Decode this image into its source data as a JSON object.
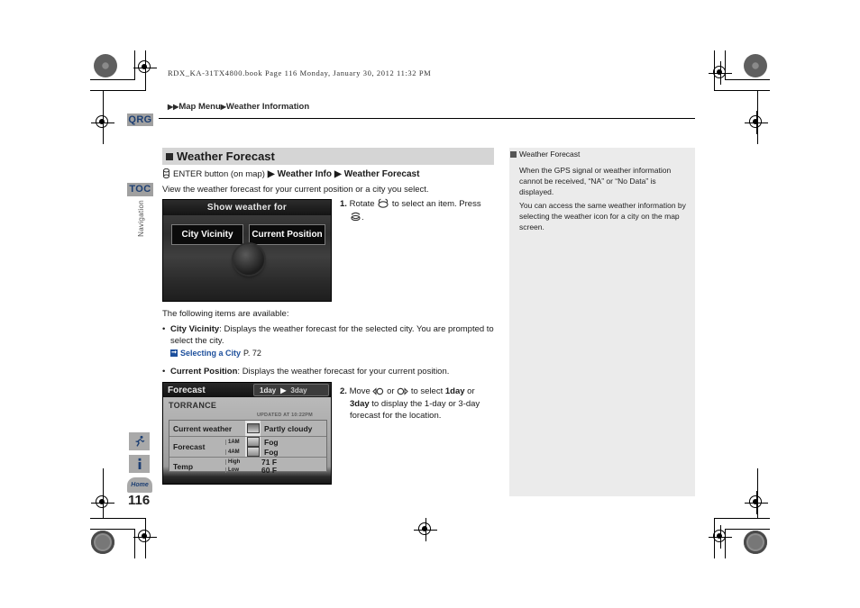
{
  "print": {
    "file_header": "RDX_KA-31TX4800.book  Page 116  Monday, January 30, 2012  11:32 PM",
    "page_number": "116"
  },
  "breadcrumb": {
    "tri1": "▶",
    "tri2": "▶",
    "item1": "Map Menu",
    "tri3": "▶",
    "item2": "Weather Information"
  },
  "rail": {
    "qrg": "QRG",
    "toc": "TOC",
    "vertical_label": "Navigation",
    "home": "Home"
  },
  "section": {
    "title": "Weather Forecast",
    "nav_path": {
      "enter": "ENTER button (on map)",
      "arrow1": "▶",
      "step1": "Weather Info",
      "arrow2": "▶",
      "step2": "Weather Forecast"
    },
    "intro": "View the weather forecast for your current position or a city you select.",
    "items_lead": "The following items are available:"
  },
  "steps": [
    {
      "num": "1.",
      "line1_a": "Rotate",
      "line1_b": "to select an item. Press"
    },
    {
      "num": "2.",
      "line1_a": "Move",
      "line1_b": "or",
      "line1_c": "to select",
      "bold1": "1day",
      "line1_d": "or",
      "bold2": "3day",
      "line2": "to display the 1-day or 3-day",
      "line3": "forecast for the location."
    }
  ],
  "bullets": [
    {
      "label": "City Vicinity",
      "text": ": Displays the weather forecast for the selected city. You are prompted to select the city.",
      "ref_label": "Selecting a City",
      "ref_page": "P. 72"
    },
    {
      "label": "Current Position",
      "text": ": Displays the weather forecast for your current position.",
      "ref_label": "",
      "ref_page": ""
    }
  ],
  "navshot1": {
    "title": "Show weather for",
    "button_left": "City Vicinity",
    "button_right": "Current Position"
  },
  "navshot2": {
    "title": "Forecast",
    "tab_1day": "1day",
    "tab_arrow": "▶",
    "tab_3day": "3day",
    "city": "TORRANCE",
    "updated": "UPDATED AT 10:22PM",
    "rows": [
      {
        "label": "Current weather",
        "sub": "",
        "icon": "partly-cloudy-icon",
        "value": "Partly cloudy"
      },
      {
        "label": "Forecast",
        "sub": "1AM",
        "icon": "fog-icon",
        "value": "Fog"
      },
      {
        "label": "",
        "sub": "4AM",
        "icon": "fog-icon",
        "value": "Fog"
      },
      {
        "label": "Temp",
        "sub": "High",
        "icon": "",
        "value": "71 F"
      },
      {
        "label": "",
        "sub": "Low",
        "icon": "",
        "value": "60 F"
      }
    ]
  },
  "note": {
    "heading": "Weather Forecast",
    "p1": "When the GPS signal or weather information cannot be received, “NA” or “No Data” is displayed.",
    "p2": "You can access the same weather information by selecting the weather icon for a city on the map screen."
  },
  "colors": {
    "accent_blue": "#1d4f9c",
    "tab_gray": "#a0a0a0",
    "section_band": "#d5d5d5",
    "note_bg": "#ebebeb"
  }
}
